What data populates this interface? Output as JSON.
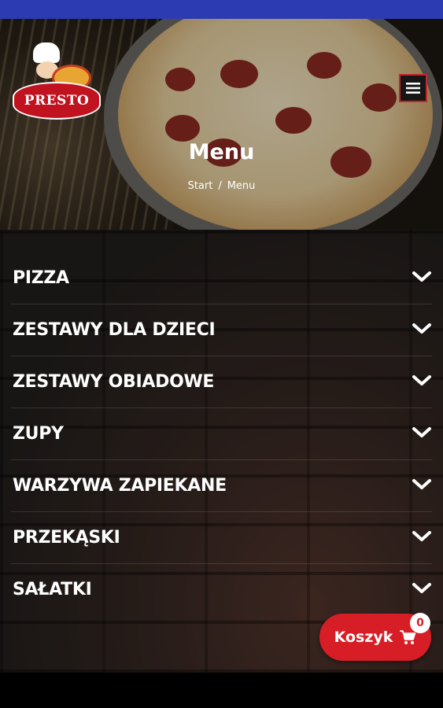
{
  "brand": {
    "logo_text": "PRESTO"
  },
  "header": {
    "title": "Menu",
    "breadcrumb": [
      "Start",
      "Menu"
    ],
    "breadcrumb_separator": "/"
  },
  "categories": [
    {
      "label": "PIZZA"
    },
    {
      "label": "ZESTAWY DLA DZIECI"
    },
    {
      "label": "ZESTAWY OBIADOWE"
    },
    {
      "label": "ZUPY"
    },
    {
      "label": "WARZYWA ZAPIEKANE"
    },
    {
      "label": "PRZEKĄSKI"
    },
    {
      "label": "SAŁATKI"
    }
  ],
  "cart": {
    "label": "Koszyk",
    "count": "0",
    "icon": "cart-icon"
  },
  "icons": {
    "menu": "hamburger-menu-icon",
    "expand": "chevron-down-icon"
  },
  "colors": {
    "status_bar": "#2d3bb2",
    "accent_red": "#d71e26",
    "text": "#ffffff"
  }
}
